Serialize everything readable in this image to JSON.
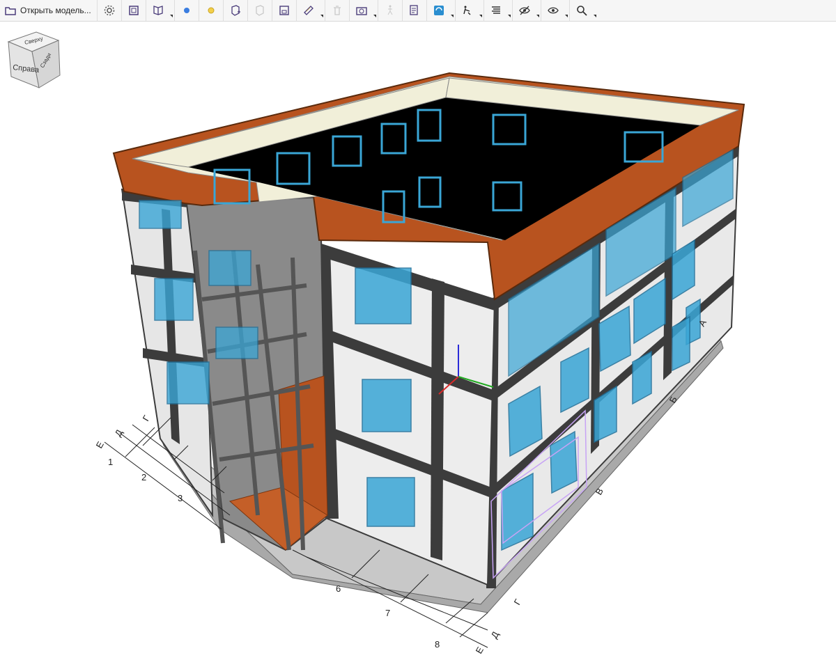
{
  "toolbar": {
    "open_model_label": "Открыть модель...",
    "items": [
      {
        "name": "settings-icon"
      },
      {
        "name": "fit-view-icon"
      },
      {
        "name": "section-plane-icon"
      },
      {
        "name": "blue-circle-icon"
      },
      {
        "name": "yellow-circle-icon"
      },
      {
        "name": "add-object-icon"
      },
      {
        "name": "move-object-icon"
      },
      {
        "name": "save-view-icon"
      },
      {
        "name": "measure-ruler-icon"
      },
      {
        "name": "delete-icon"
      },
      {
        "name": "camera-icon"
      },
      {
        "name": "walk-icon"
      },
      {
        "name": "properties-icon"
      },
      {
        "name": "layers-icon"
      },
      {
        "name": "explode-icon"
      },
      {
        "name": "list-icon"
      },
      {
        "name": "hide-icon"
      },
      {
        "name": "show-icon"
      },
      {
        "name": "search-icon"
      }
    ]
  },
  "viewcube": {
    "face_right": "Справа",
    "face_top": "Сверху",
    "face_front": "Сзади"
  },
  "grid_axes": {
    "numbers": [
      "1",
      "2",
      "3",
      "6",
      "7",
      "8"
    ],
    "letters_left": [
      "Г",
      "Д",
      "Е"
    ],
    "letters_right": [
      "В",
      "Б",
      "А",
      "Г",
      "Д",
      "Е"
    ]
  },
  "colors": {
    "roof_parapet": "#b8531f",
    "wall_panel": "#ececec",
    "frame": "#3c3c3c",
    "window": "#3aa6d6",
    "roof_interior": "#000000",
    "parapet_inner": "#f1efd9"
  }
}
